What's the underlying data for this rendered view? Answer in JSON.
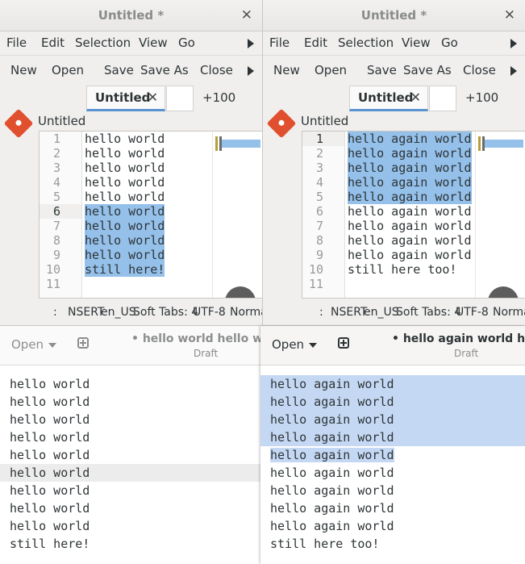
{
  "left_editor": {
    "title": "Untitled *",
    "menu": [
      "File",
      "Edit",
      "Selection",
      "View",
      "Go"
    ],
    "toolbar": [
      "New",
      "Open",
      "Save",
      "Save As",
      "Close"
    ],
    "tab_label": "Untitled",
    "tab_count": "+100",
    "git_file": "Untitled",
    "line_numbers": [
      "1",
      "2",
      "3",
      "4",
      "5",
      "6",
      "7",
      "8",
      "9",
      "10",
      "11"
    ],
    "current_line": 6,
    "lines": [
      "hello world",
      "hello world",
      "hello world",
      "hello world",
      "hello world",
      "hello world",
      "hello world",
      "hello world",
      "hello world",
      "still here!",
      ""
    ],
    "status": [
      ":",
      "NSERT",
      "en_US",
      "Soft Tabs: 4",
      "UTF-8",
      "Norma"
    ]
  },
  "right_editor": {
    "title": "Untitled *",
    "menu": [
      "File",
      "Edit",
      "Selection",
      "View",
      "Go"
    ],
    "toolbar": [
      "New",
      "Open",
      "Save",
      "Save As",
      "Close"
    ],
    "tab_label": "Untitled",
    "tab_count": "+100",
    "git_file": "Untitled",
    "line_numbers": [
      "1",
      "2",
      "3",
      "4",
      "5",
      "6",
      "7",
      "8",
      "9",
      "10",
      "11"
    ],
    "current_line": 1,
    "lines": [
      "hello again world",
      "hello again world",
      "hello again world",
      "hello again world",
      "hello again world",
      "hello again world",
      "hello again world",
      "hello again world",
      "hello again world",
      "still here too!",
      ""
    ],
    "status": [
      ":",
      "NSERT",
      "en_US",
      "Soft Tabs: 4",
      "UTF-8",
      "Norma"
    ]
  },
  "left_text": {
    "open_label": "Open",
    "doc_title": "• hello world hello world",
    "doc_sub": "Draft",
    "lines": [
      "hello world",
      "hello world",
      "hello world",
      "hello world",
      "hello world",
      "hello world",
      "hello world",
      "hello world",
      "hello world",
      "still here!"
    ]
  },
  "right_text": {
    "open_label": "Open",
    "doc_title": "• hello again world hello",
    "doc_sub": "Draft",
    "lines": [
      "hello again world",
      "hello again world",
      "hello again world",
      "hello again world",
      "hello again world",
      "hello again world",
      "hello again world",
      "hello again world",
      "hello again world",
      "still here too!"
    ]
  },
  "colors": {
    "selection": "#94c0ea",
    "text_selection": "#c4d8f3",
    "tab_accent": "#5b93d0",
    "git": "#e0502f"
  }
}
